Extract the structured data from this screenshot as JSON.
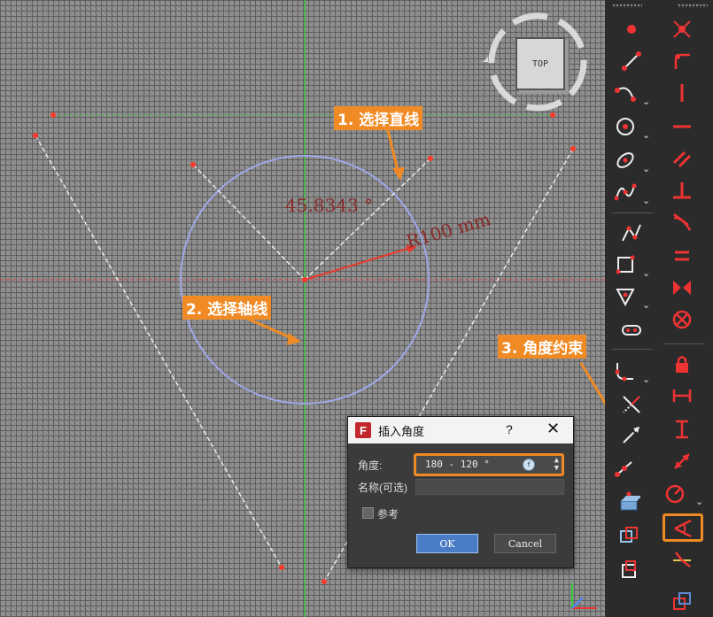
{
  "annotations": {
    "step1": "1. 选择直线",
    "step2": "2. 选择轴线",
    "step3": "3. 角度约束"
  },
  "sketch": {
    "angle_dimension": "45.8343 °",
    "radius_dimension": "R100 mm"
  },
  "navcube": {
    "face_label": "TOP"
  },
  "dialog": {
    "logo": "F",
    "title": "插入角度",
    "help": "?",
    "close": "✕",
    "angle_label": "角度:",
    "angle_value": "180 - 120 °",
    "name_label": "名称(可选)",
    "name_value": "",
    "reference_label": "参考",
    "ok_label": "OK",
    "cancel_label": "Cancel"
  },
  "toolbar": {
    "left_tools": [
      "point-tool",
      "line-tool",
      "arc-tool",
      "circle-tool",
      "conic-tool",
      "bspline-tool",
      "polyline-tool",
      "rectangle-tool",
      "polygon-tool",
      "slot-tool",
      "fillet-tool",
      "trim-tool",
      "extend-tool",
      "external-geometry-tool",
      "carbon-copy-tool",
      "construction-mode-tool",
      "clone-tool"
    ],
    "right_tools": [
      "coincident-constraint",
      "point-on-object-constraint",
      "vertical-constraint",
      "horizontal-constraint",
      "parallel-constraint",
      "perpendicular-constraint",
      "tangent-constraint",
      "equal-constraint",
      "symmetric-constraint",
      "block-constraint",
      "lock-constraint",
      "horizontal-distance-constraint",
      "vertical-distance-constraint",
      "distance-constraint",
      "radius-constraint",
      "angle-constraint",
      "snell-constraint",
      "toggle-driving-constraint"
    ],
    "accent_color": "#f08a24",
    "tool_color": "#e33333"
  }
}
